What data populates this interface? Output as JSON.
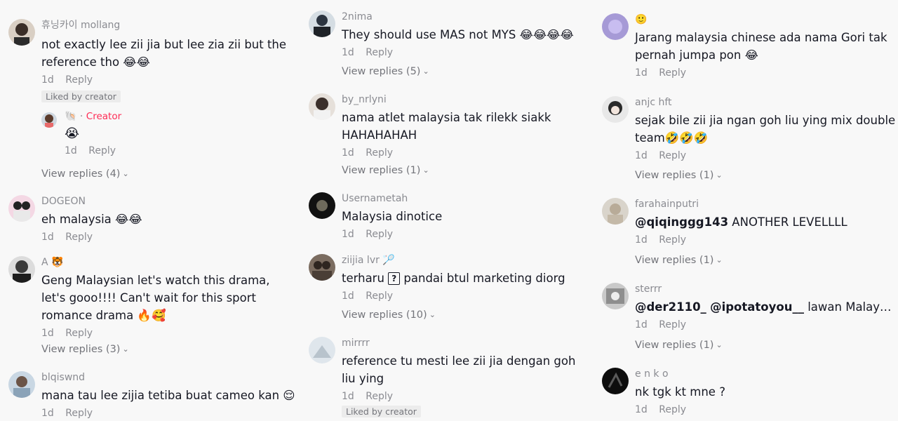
{
  "columns": [
    {
      "comments": [
        {
          "username": "휴닝카이 mollang",
          "text": "not exactly lee zii jia but lee zia zii but the reference tho 😂😂",
          "time": "1d",
          "reply": "Reply",
          "liked": "Liked by creator",
          "creator_reply": {
            "username": "🐚 · ",
            "badge": "Creator",
            "text": "😭",
            "time": "1d",
            "reply": "Reply"
          },
          "view_replies": "View replies (4)"
        },
        {
          "username": "DOGEON",
          "text": "eh malaysia 😂😂",
          "time": "1d",
          "reply": "Reply"
        },
        {
          "username": "A 🐯",
          "text": "Geng Malaysian let's watch this drama, let's gooo!!!! Can't wait for this sport romance drama 🔥🥰",
          "time": "1d",
          "reply": "Reply",
          "view_replies": "View replies (3)"
        },
        {
          "username": "blqiswnd",
          "text": "mana tau lee zijia tetiba buat cameo kan 😌",
          "time": "1d",
          "reply": "Reply"
        }
      ]
    },
    {
      "comments": [
        {
          "username": "2nima",
          "text": "They should use MAS not MYS 😂😂😂😂",
          "time": "1d",
          "reply": "Reply",
          "view_replies": "View replies (5)"
        },
        {
          "username": "by_nrlyni",
          "text": "nama atlet malaysia tak rilekk siakk HAHAHAHAH",
          "time": "1d",
          "reply": "Reply",
          "view_replies": "View replies (1)"
        },
        {
          "username": "Usernametah",
          "text": "Malaysia dinotice",
          "time": "1d",
          "reply": "Reply"
        },
        {
          "username": "ziijia lvr 🏸",
          "text_pre": "terharu ",
          "text_box": "?",
          "text_post": " pandai btul marketing diorg",
          "time": "1d",
          "reply": "Reply",
          "view_replies": "View replies (10)"
        },
        {
          "username": "mirrrr",
          "text": "reference tu mesti lee zii jia dengan goh liu ying",
          "time": "1d",
          "reply": "Reply",
          "liked": "Liked by creator"
        }
      ]
    },
    {
      "comments": [
        {
          "username": "🙂",
          "text": "Jarang malaysia chinese ada nama Gori tak pernah jumpa pon 😂",
          "time": "1d",
          "reply": "Reply"
        },
        {
          "username": "anjc hft",
          "text": "sejak bile zii jia ngan goh liu ying mix double team🤣🤣🤣",
          "time": "1d",
          "reply": "Reply",
          "view_replies": "View replies (1)"
        },
        {
          "username": "farahainputri",
          "mention": "@qiqinggg143",
          "text": " ANOTHER LEVELLLL",
          "time": "1d",
          "reply": "Reply",
          "view_replies": "View replies (1)"
        },
        {
          "username": "sterrr",
          "mention1": "@der2110_",
          "mention2": "@ipotatoyou__",
          "text": " lawan Malaysia o…",
          "time": "1d",
          "reply": "Reply",
          "view_replies": "View replies (1)"
        },
        {
          "username": "e n k o",
          "text": "nk tgk kt mne ?",
          "time": "1d",
          "reply": "Reply"
        }
      ]
    }
  ],
  "chevron": "⌄"
}
